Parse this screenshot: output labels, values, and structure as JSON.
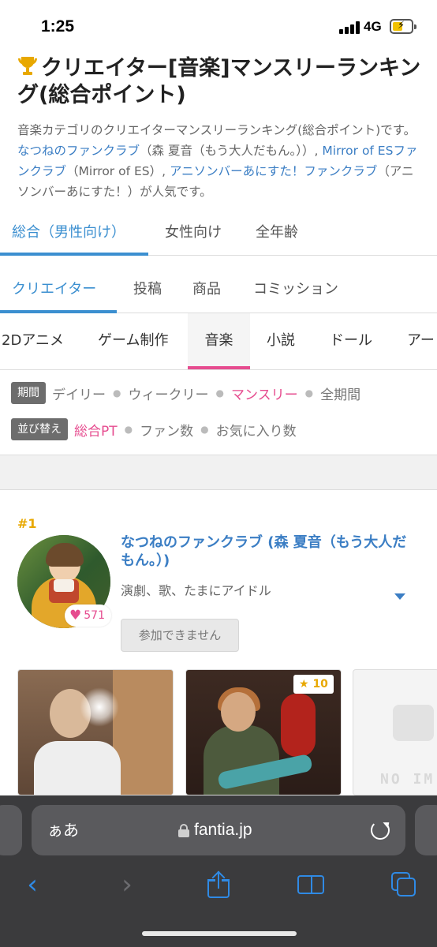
{
  "status_bar": {
    "time": "1:25",
    "network": "4G"
  },
  "heading": {
    "title": "クリエイター[音楽]マンスリーランキング(総合ポイント)"
  },
  "description": {
    "pre": "音楽カテゴリのクリエイターマンスリーランキング(総合ポイント)です。",
    "link1": "なつねのファンクラブ",
    "mid1": "（森 夏音（もう大人だもん。））, ",
    "link2": "Mirror of ESファンクラブ",
    "mid2": "（Mirror of ES）, ",
    "link3": "アニソンバーあにすた！ファンクラブ",
    "post": "（アニソンバーあにすた！）が人気です。"
  },
  "audience_tabs": [
    "総合（男性向け）",
    "女性向け",
    "全年齢"
  ],
  "type_tabs": [
    "クリエイター",
    "投稿",
    "商品",
    "コミッション"
  ],
  "category_tabs": [
    "2Dアニメ",
    "ゲーム制作",
    "音楽",
    "小説",
    "ドール",
    "アー"
  ],
  "filters": {
    "period_label": "期間",
    "period_options": [
      "デイリー",
      "ウィークリー",
      "マンスリー",
      "全期間"
    ],
    "sort_label": "並び替え",
    "sort_options": [
      "総合PT",
      "ファン数",
      "お気に入り数"
    ]
  },
  "ranking": [
    {
      "rank": "#1",
      "name": "なつねのファンクラブ (森 夏音（もう大人だもん。）)",
      "description": "演劇、歌、たまにアイドル",
      "likes": "571",
      "join_label": "参加できません",
      "posts": [
        {
          "badge": ""
        },
        {
          "badge": "10"
        },
        {
          "badge": "",
          "placeholder": "NO IM"
        }
      ]
    }
  ],
  "browser": {
    "aa_label": "ぁあ",
    "url": "fantia.jp"
  },
  "colors": {
    "link": "#3b7ec4",
    "active_tab": "#3b8fd0",
    "accent_pink": "#e64c8f",
    "rank_gold": "#e8a800",
    "ios_blue": "#2f8ae5"
  }
}
